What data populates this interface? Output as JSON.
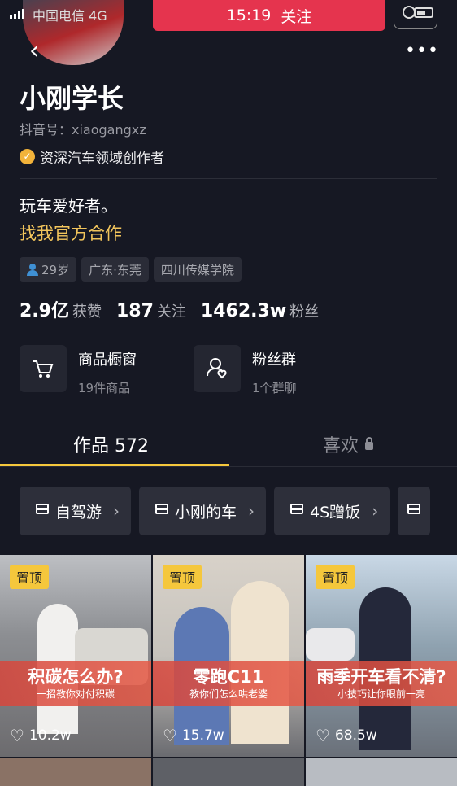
{
  "status_bar": {
    "carrier": "中国电信",
    "network": "4G",
    "time": "15:19",
    "banner_label": "关注"
  },
  "profile": {
    "name": "小刚学长",
    "douyin_id": "抖音号：xiaogangxz",
    "certification": "资深汽车领域创作者",
    "bio": "玩车爱好者。",
    "cooperation": "找我官方合作",
    "tags": [
      "29岁",
      "广东·东莞",
      "四川传媒学院"
    ]
  },
  "stats": {
    "likes_value": "2.9亿",
    "likes_label": "获赞",
    "following_value": "187",
    "following_label": "关注",
    "fans_value": "1462.3w",
    "fans_label": "粉丝"
  },
  "services": [
    {
      "title": "商品橱窗",
      "sub": "19件商品",
      "icon": "cart-icon"
    },
    {
      "title": "粉丝群",
      "sub": "1个群聊",
      "icon": "fan-group-icon"
    }
  ],
  "tabs": {
    "works": "作品 572",
    "likes": "喜欢"
  },
  "collections": [
    "自驾游",
    "小刚的车",
    "4S蹭饭"
  ],
  "videos": [
    {
      "pin": "置顶",
      "title": "积碳怎么办?",
      "subtitle": "一招教你对付积碳",
      "likes": "10.2w"
    },
    {
      "pin": "置顶",
      "title": "零跑C11",
      "subtitle": "教你们怎么哄老婆",
      "likes": "15.7w"
    },
    {
      "pin": "置顶",
      "title": "雨季开车看不清?",
      "subtitle": "小技巧让你眼前一亮",
      "likes": "68.5w"
    }
  ],
  "colors": {
    "background": "#161823",
    "accent_yellow": "#f5c73c",
    "banner_red": "#e5344e",
    "cert_gold": "#f2b33a"
  }
}
